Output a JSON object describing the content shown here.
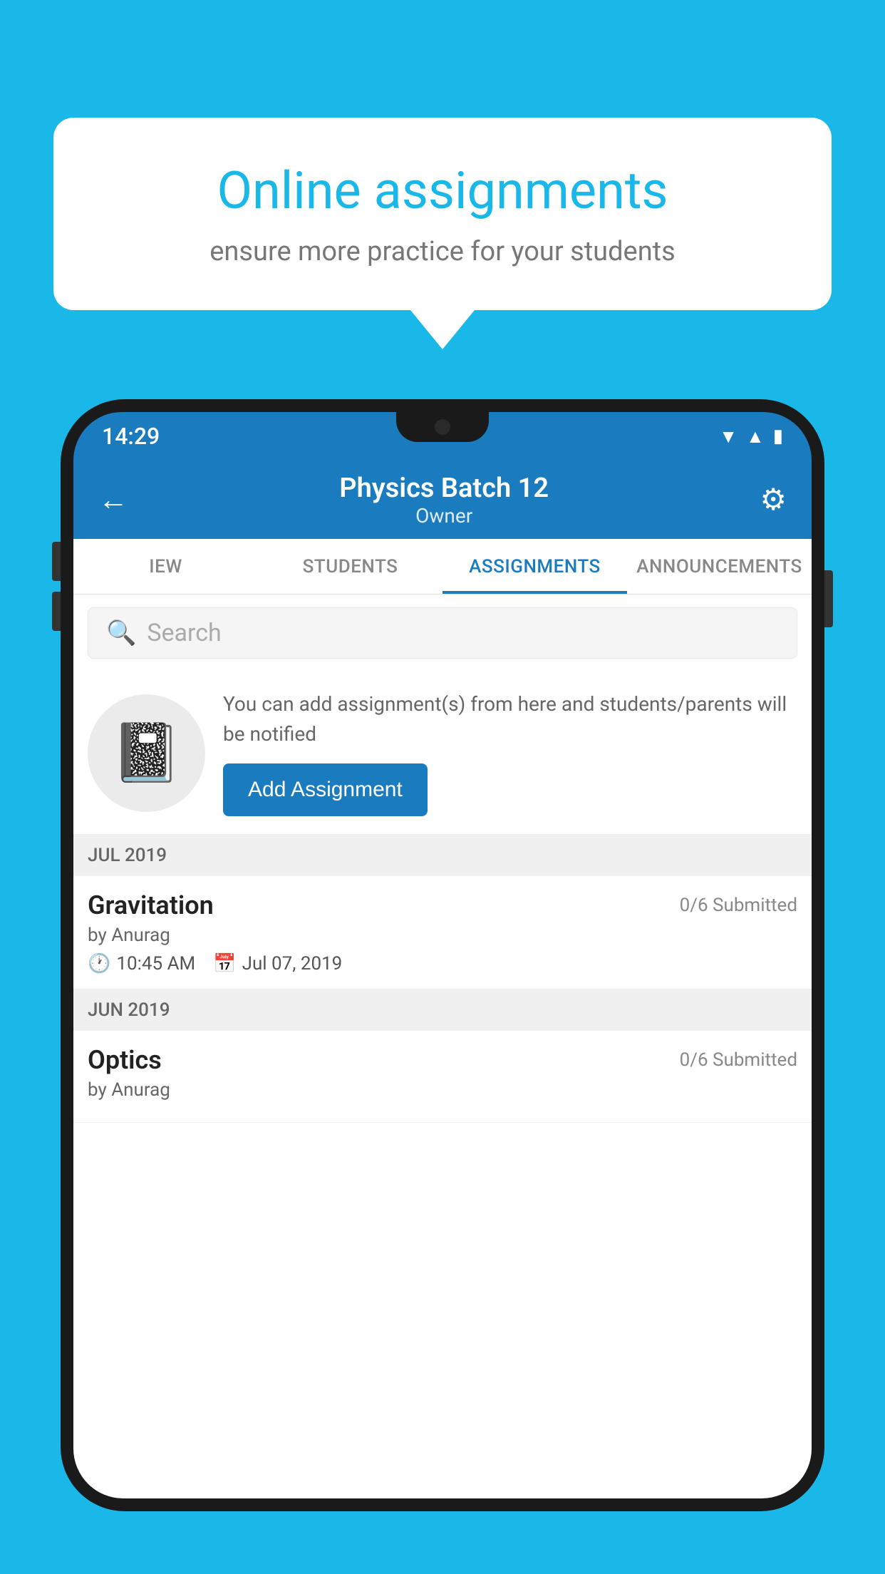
{
  "background_color": "#1ab8e8",
  "speech_bubble": {
    "title": "Online assignments",
    "subtitle": "ensure more practice for your students"
  },
  "phone": {
    "status_bar": {
      "time": "14:29",
      "icons": [
        "wifi",
        "signal",
        "battery"
      ]
    },
    "header": {
      "title": "Physics Batch 12",
      "subtitle": "Owner",
      "back_label": "←",
      "settings_label": "⚙"
    },
    "tabs": [
      {
        "label": "IEW",
        "active": false
      },
      {
        "label": "STUDENTS",
        "active": false
      },
      {
        "label": "ASSIGNMENTS",
        "active": true
      },
      {
        "label": "ANNOUNCEMENTS",
        "active": false
      }
    ],
    "search": {
      "placeholder": "Search"
    },
    "add_assignment_prompt": {
      "description": "You can add assignment(s) from here and students/parents will be notified",
      "button_label": "Add Assignment"
    },
    "sections": [
      {
        "month": "JUL 2019",
        "assignments": [
          {
            "title": "Gravitation",
            "submitted": "0/6 Submitted",
            "author": "by Anurag",
            "time": "10:45 AM",
            "date": "Jul 07, 2019"
          }
        ]
      },
      {
        "month": "JUN 2019",
        "assignments": [
          {
            "title": "Optics",
            "submitted": "0/6 Submitted",
            "author": "by Anurag",
            "time": "",
            "date": ""
          }
        ]
      }
    ]
  }
}
